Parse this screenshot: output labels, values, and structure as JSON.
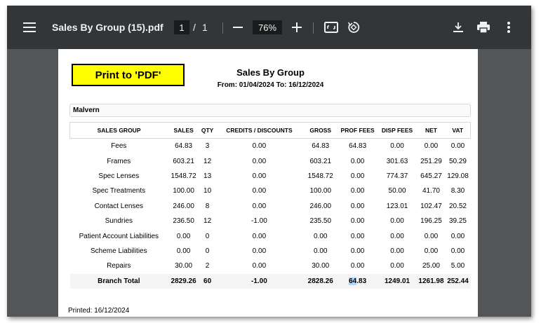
{
  "toolbar": {
    "title": "Sales By Group (15).pdf",
    "page_current": "1",
    "page_separator": "/",
    "page_total": "1",
    "zoom": "76%"
  },
  "report": {
    "print_button": "Print to 'PDF'",
    "title": "Sales By Group",
    "date_range": "From: 01/04/2024 To: 16/12/2024",
    "branch": "Malvern",
    "headers": [
      "SALES GROUP",
      "SALES",
      "QTY",
      "CREDITS / DISCOUNTS",
      "GROSS",
      "PROF FEES",
      "DISP FEES",
      "NET",
      "VAT"
    ],
    "rows": [
      [
        "Fees",
        "64.83",
        "3",
        "0.00",
        "64.83",
        "64.83",
        "0.00",
        "0.00",
        "0.00"
      ],
      [
        "Frames",
        "603.21",
        "12",
        "0.00",
        "603.21",
        "0.00",
        "301.63",
        "251.29",
        "50.29"
      ],
      [
        "Spec Lenses",
        "1548.72",
        "13",
        "0.00",
        "1548.72",
        "0.00",
        "774.37",
        "645.27",
        "129.08"
      ],
      [
        "Spec Treatments",
        "100.00",
        "10",
        "0.00",
        "100.00",
        "0.00",
        "50.00",
        "41.70",
        "8.30"
      ],
      [
        "Contact Lenses",
        "246.00",
        "8",
        "0.00",
        "246.00",
        "0.00",
        "123.01",
        "102.47",
        "20.52"
      ],
      [
        "Sundries",
        "236.50",
        "12",
        "-1.00",
        "235.50",
        "0.00",
        "0.00",
        "196.25",
        "39.25"
      ],
      [
        "Patient Account Liabilities",
        "0.00",
        "0",
        "0.00",
        "0.00",
        "0.00",
        "0.00",
        "0.00",
        "0.00"
      ],
      [
        "Scheme Liabilities",
        "0.00",
        "0",
        "0.00",
        "0.00",
        "0.00",
        "0.00",
        "0.00",
        "0.00"
      ],
      [
        "Repairs",
        "30.00",
        "2",
        "0.00",
        "30.00",
        "0.00",
        "0.00",
        "25.00",
        "5.00"
      ]
    ],
    "total": {
      "label": "Branch Total",
      "sales": "2829.26",
      "qty": "60",
      "credits": "-1.00",
      "gross": "2828.26",
      "prof_fees_selected": "64",
      "prof_fees_rest": ".83",
      "disp_fees": "1249.01",
      "net": "1261.98",
      "vat": "252.44"
    },
    "printed": "Printed: 16/12/2024"
  },
  "colors": {
    "toolbar_bg": "#323639",
    "viewer_bg": "#525659",
    "print_button_bg": "#ffff00",
    "selection_highlight": "#b3d4fc"
  }
}
